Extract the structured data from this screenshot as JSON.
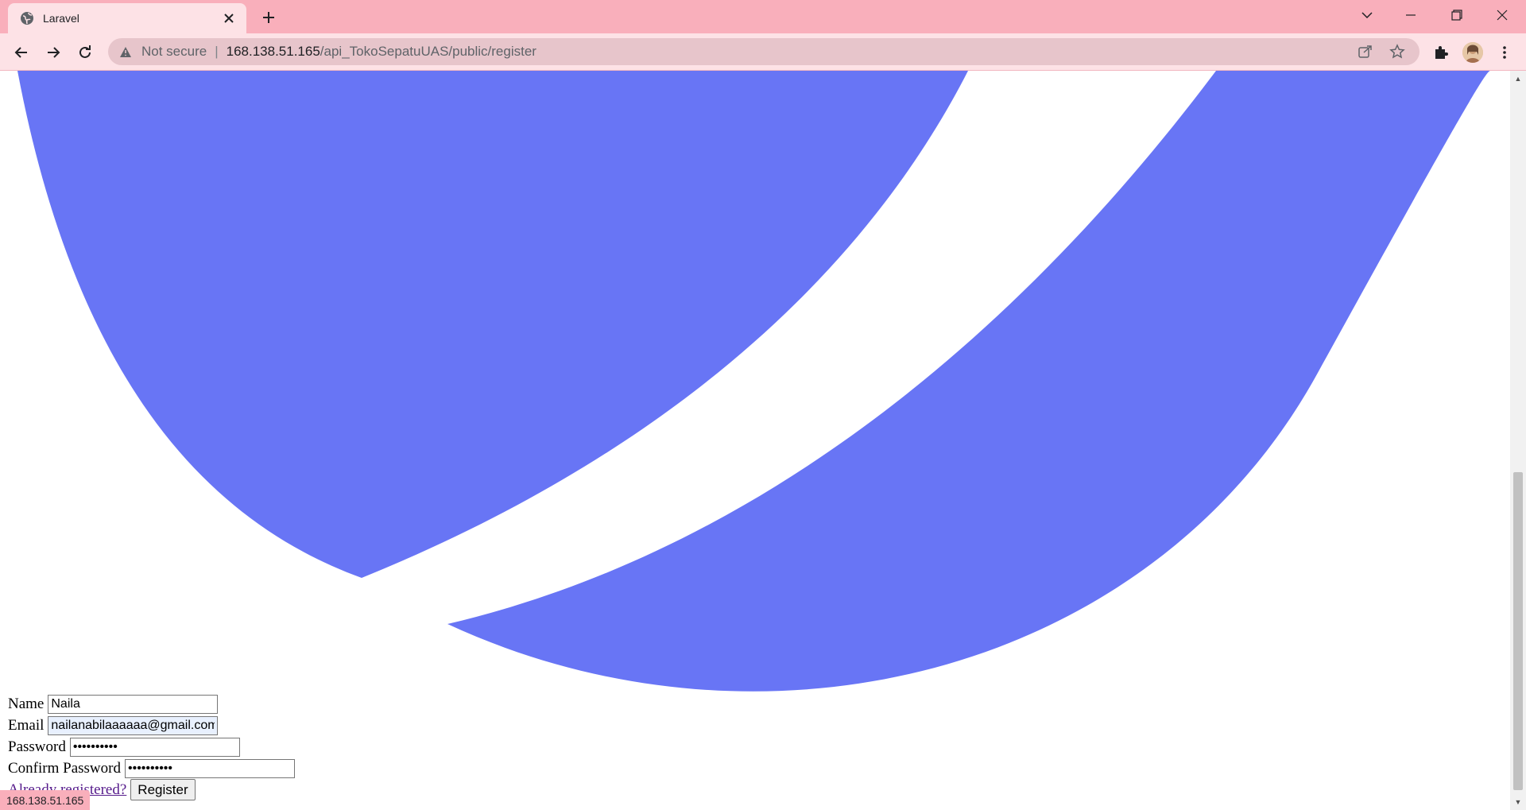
{
  "browser": {
    "tab_title": "Laravel",
    "security_label": "Not secure",
    "url_host": "168.138.51.165",
    "url_path": "/api_TokoSepatuUAS/public/register",
    "status_text": "168.138.51.165"
  },
  "form": {
    "name_label": "Name",
    "name_value": "Naila",
    "email_label": "Email",
    "email_value": "nailanabilaaaaaa@gmail.com",
    "password_label": "Password",
    "password_value": "••••••••••",
    "confirm_label": "Confirm Password",
    "confirm_value": "••••••••••",
    "already_link": "Already registered?",
    "register_button": "Register"
  },
  "colors": {
    "logo": "#6875f5",
    "chrome": "#f9afbb"
  },
  "icons": [
    "globe-icon",
    "close-icon",
    "plus-icon",
    "chevron-down-icon",
    "minimize-icon",
    "restore-icon",
    "window-close-icon",
    "back-icon",
    "forward-icon",
    "reload-icon",
    "warning-icon",
    "share-icon",
    "star-icon",
    "puzzle-icon",
    "avatar",
    "kebab-menu-icon"
  ]
}
